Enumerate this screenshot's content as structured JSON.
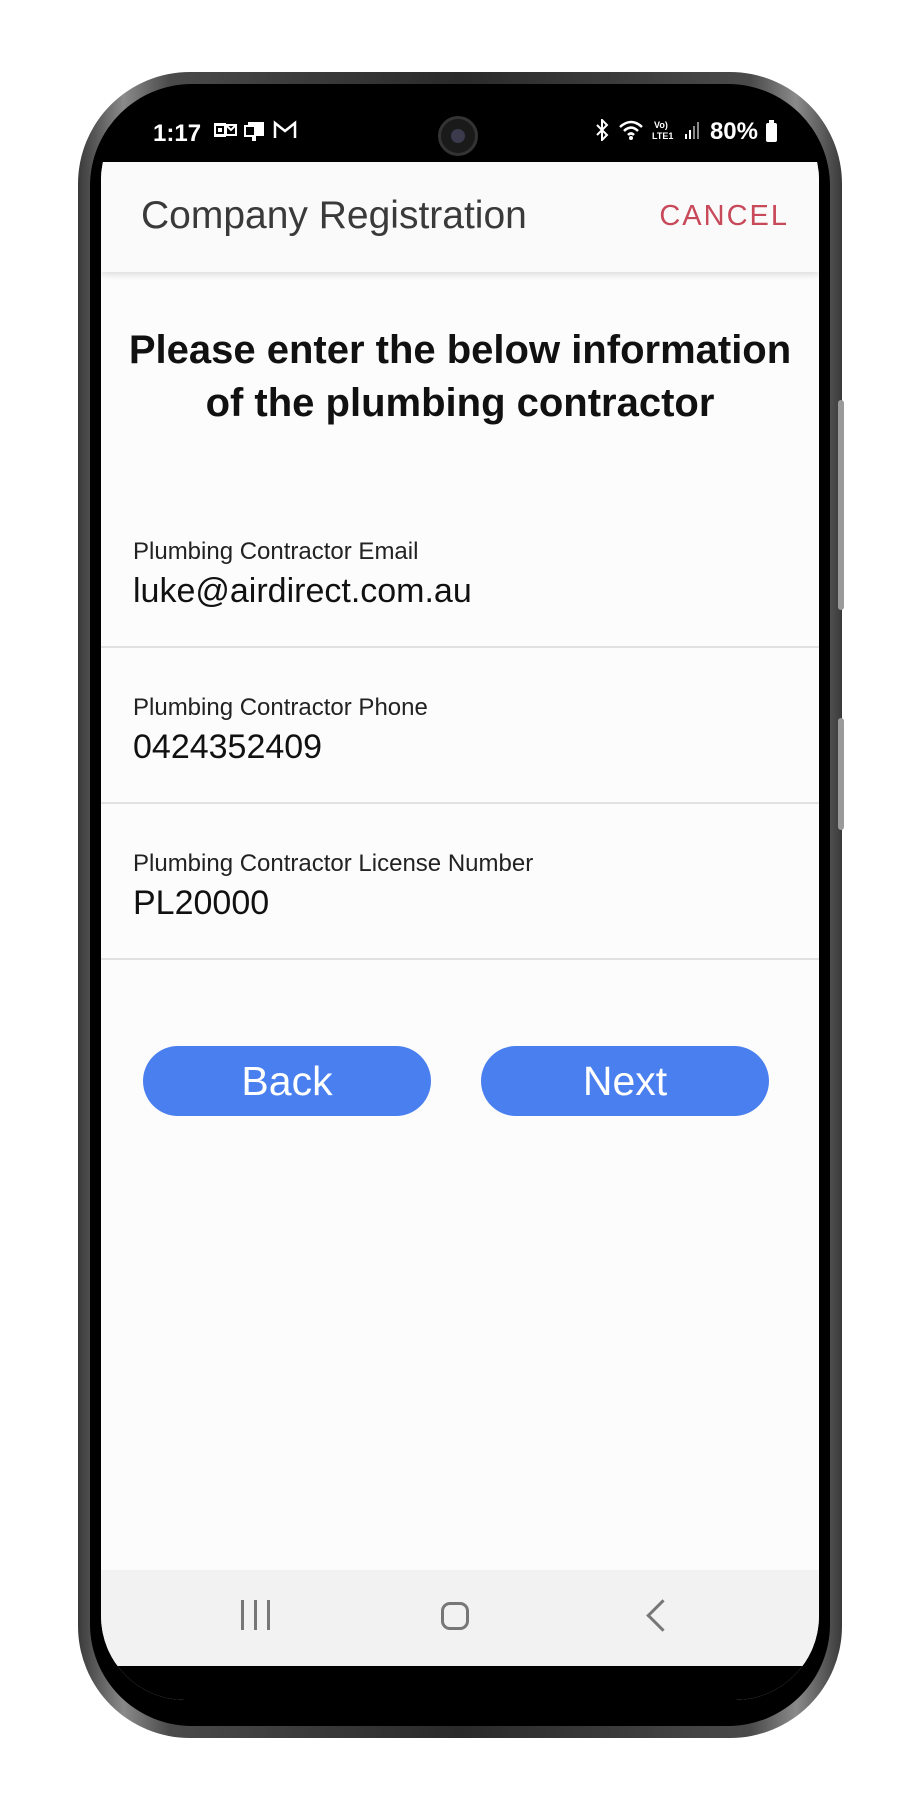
{
  "status_bar": {
    "time": "1:17",
    "battery": "80%",
    "left_icons": [
      "outlook-icon",
      "clipboard-icon",
      "gmail-icon"
    ],
    "right_icons": [
      "bluetooth-icon",
      "wifi-icon",
      "volte-icon",
      "signal-icon",
      "battery-icon"
    ]
  },
  "header": {
    "title": "Company Registration",
    "cancel_label": "CANCEL",
    "cancel_color": "#c84a5a"
  },
  "main": {
    "instruction_line1": "Please enter the below information",
    "instruction_line2": "of the plumbing contractor",
    "fields": [
      {
        "label": "Plumbing Contractor Email",
        "value": "luke@airdirect.com.au"
      },
      {
        "label": "Plumbing Contractor Phone",
        "value": "0424352409"
      },
      {
        "label": "Plumbing Contractor License Number",
        "value": "PL20000"
      }
    ],
    "back_label": "Back",
    "next_label": "Next",
    "button_color": "#4a7ff0"
  },
  "nav_bar": {
    "items": [
      "recents-icon",
      "home-icon",
      "back-icon"
    ]
  }
}
